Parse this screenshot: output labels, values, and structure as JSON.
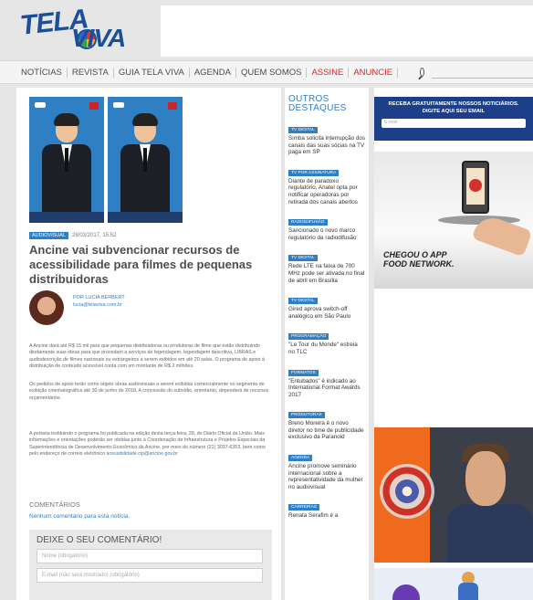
{
  "header": {
    "logo": "TELA VIVA"
  },
  "nav": {
    "items": [
      {
        "label": "NOTÍCIAS",
        "accent": false
      },
      {
        "label": "REVISTA",
        "accent": false
      },
      {
        "label": "GUIA TELA VIVA",
        "accent": false
      },
      {
        "label": "AGENDA",
        "accent": false
      },
      {
        "label": "QUEM SOMOS",
        "accent": false
      },
      {
        "label": "ASSINE",
        "accent": true
      },
      {
        "label": "ANUNCIE",
        "accent": true
      }
    ],
    "search_icon": "search-icon",
    "accent_color": "#d7262a"
  },
  "article": {
    "category": "AUDIOVISUAL",
    "date": "28/03/2017, 15:52",
    "title": "Ancine vai subvencionar recursos de acessibilidade para filmes de pequenas distribuidoras",
    "author_by": "POR LUCIA BERBERT",
    "author_email": "lucia@telaviva.com.br",
    "paragraphs": [
      "A Ancine dará até R$ 15 mil para que pequenas distribuidoras ou produtoras de filme que estão distribuindo diretamente suas obras para que procedam a serviços de legendagem, legendagem descritiva, LIBRAS e audiodescrição de filmes nacionais ou estrangeiros a serem exibidos em até 20 salas. O programa de apoio à distribuição de conteúdo acessível conta com um montante de R$ 2 milhões.",
      "Os pedidos de apoio terão como objeto obras audiovisuais a serem exibidas comercialmente no segmento de exibição cinematográfica até 30 de junho de 2018. A concessão do subsídio, entretanto, dependerá de recursos orçamentários.",
      "A portaria instituindo o programa foi publicada na edição desta terça-feira, 28, do Diário Oficial da União. Mais informações e orientações poderão ser obtidas junto à Coordenação de Infraestrutura e Projetos Especiais da Superintendência de Desenvolvimento Econômico da Ancine, por meio do número (21) 3037-6353, bem como pelo endereço de correio eletrônico"
    ],
    "email_link": "acessibilidade.cip@ancine.gov.br",
    "comments_heading": "COMENTÁRIOS",
    "no_comments": "Nenhum comentário para esta notícia.",
    "form_title": "DEIXE O SEU COMENTÁRIO!",
    "name_placeholder": "Nome (obrigatório)",
    "email_placeholder": "E-mail (não será mostrado) (obrigatório)"
  },
  "side": {
    "title_line1": "OUTROS",
    "title_line2": "DESTAQUES",
    "items": [
      {
        "tag": "TV DIGITAL",
        "text": "Simba solicita interrupção dos canais das suas sócias na TV paga em SP"
      },
      {
        "tag": "TV POR ASSINATURA",
        "text": "Diante de paradoxo regulatório, Anatel opta por notificar operadoras por retirada dos canais abertos"
      },
      {
        "tag": "RADIODIFUSÃO",
        "text": "Sancionado o novo marco regulatório da radiodifusão"
      },
      {
        "tag": "TV DIGITAL",
        "text": "Rede LTE na faixa de 700 MHz pode ser ativada no final de abril em Brasília"
      },
      {
        "tag": "TV DIGITAL",
        "text": "Gired aprova switch-off analógico em São Paulo"
      },
      {
        "tag": "PROGRAMAÇÃO",
        "text": "\"Le Tour du Monde\" estreia no TLC"
      },
      {
        "tag": "FORMATOS",
        "text": "\"Entubados\" é indicado ao International Format Awards 2017"
      },
      {
        "tag": "PRODUTORAS",
        "text": "Breno Moreira é o novo diretor no time de publicidade exclusivo da Paranoid"
      },
      {
        "tag": "AGENDA",
        "text": "Ancine promove seminário internacional sobre a representatividade da mulher no audiovisual"
      },
      {
        "tag": "CARREIRAS",
        "text": "Renata Serafim é a"
      }
    ]
  },
  "right": {
    "newsletter_text": "RECEBA GRATUITAMENTE NOSSOS NOTICIÁRIOS. DIGITE AQUI SEU EMAIL",
    "newsletter_placeholder": "E-mail",
    "ad_food_line1": "CHEGOU O APP",
    "ad_food_line2": "FOOD NETWORK."
  }
}
